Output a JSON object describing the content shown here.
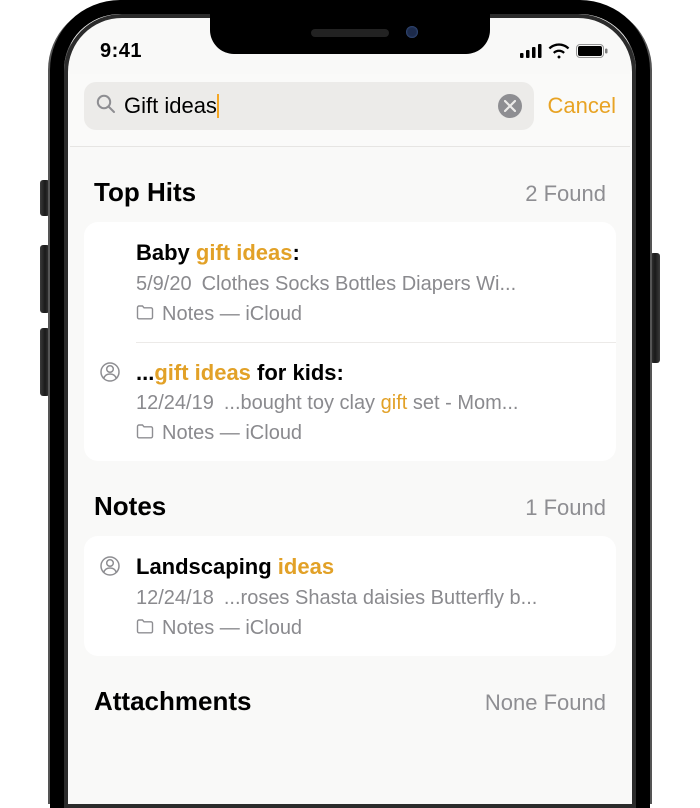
{
  "status": {
    "time": "9:41"
  },
  "search": {
    "query": "Gift ideas",
    "cancel": "Cancel"
  },
  "sections": {
    "top_hits": {
      "title": "Top Hits",
      "count": "2 Found",
      "items": [
        {
          "title_prefix": "Baby ",
          "title_highlight": "gift ideas",
          "title_suffix": ":",
          "date": "5/9/20",
          "snippet_before": "Clothes Socks Bottles Diapers Wi...",
          "snippet_highlight": "",
          "snippet_after": "",
          "folder": "Notes — iCloud",
          "shared": false
        },
        {
          "title_prefix": "...",
          "title_highlight": "gift ideas",
          "title_suffix": " for kids:",
          "date": "12/24/19",
          "snippet_before": "...bought toy clay ",
          "snippet_highlight": "gift",
          "snippet_after": " set - Mom...",
          "folder": "Notes — iCloud",
          "shared": true
        }
      ]
    },
    "notes": {
      "title": "Notes",
      "count": "1 Found",
      "items": [
        {
          "title_prefix": "Landscaping ",
          "title_highlight": "ideas",
          "title_suffix": "",
          "date": "12/24/18",
          "snippet_before": "...roses Shasta daisies Butterfly b...",
          "snippet_highlight": "",
          "snippet_after": "",
          "folder": "Notes — iCloud",
          "shared": true
        }
      ]
    },
    "attachments": {
      "title": "Attachments",
      "count": "None Found"
    }
  }
}
